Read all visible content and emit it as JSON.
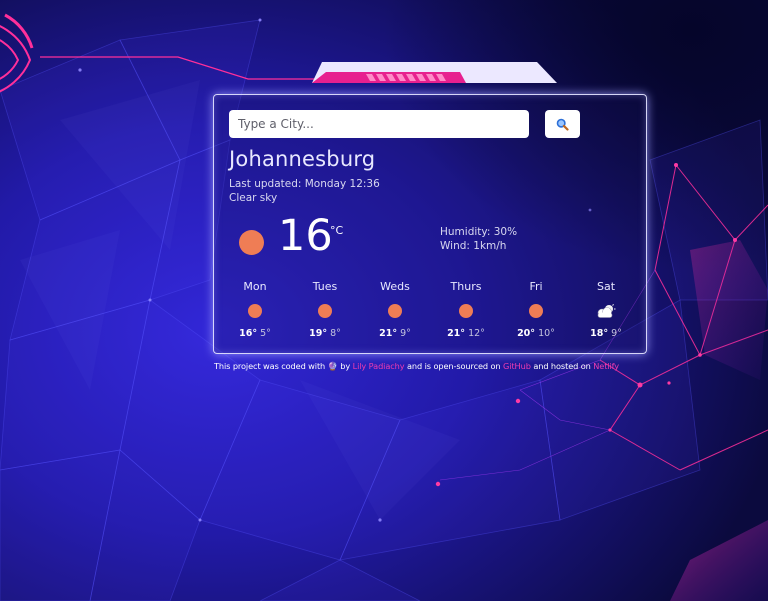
{
  "search": {
    "placeholder": "Type a City...",
    "value": "",
    "button_icon": "magnifying-glass-icon"
  },
  "current": {
    "city": "Johannesburg",
    "last_updated": "Last updated: Monday 12:36",
    "description": "Clear sky",
    "temperature": "16",
    "unit": "°C",
    "icon": "sun-icon",
    "humidity": "Humidity: 30%",
    "wind": "Wind: 1km/h"
  },
  "forecast": [
    {
      "day": "Mon",
      "icon": "sun-icon",
      "high": "16°",
      "low": "5°"
    },
    {
      "day": "Tues",
      "icon": "sun-icon",
      "high": "19°",
      "low": "8°"
    },
    {
      "day": "Weds",
      "icon": "sun-icon",
      "high": "21°",
      "low": "9°"
    },
    {
      "day": "Thurs",
      "icon": "sun-icon",
      "high": "21°",
      "low": "12°"
    },
    {
      "day": "Fri",
      "icon": "sun-icon",
      "high": "20°",
      "low": "10°"
    },
    {
      "day": "Sat",
      "icon": "partly-cloudy-icon",
      "high": "18°",
      "low": "9°"
    }
  ],
  "footer": {
    "text_1": "This project was coded with ",
    "emoji": "🔮",
    "text_2": " by ",
    "author_link": "Lily Padiachy",
    "text_3": " and is open-sourced on ",
    "github_link": "GitHub",
    "text_4": " and hosted on ",
    "netlify_link": "Netlify"
  },
  "colors": {
    "accent_pink": "#ee3cb0",
    "sun_orange": "#ef7d55",
    "background_navy": "#12105e",
    "background_blue": "#2a24c8"
  }
}
